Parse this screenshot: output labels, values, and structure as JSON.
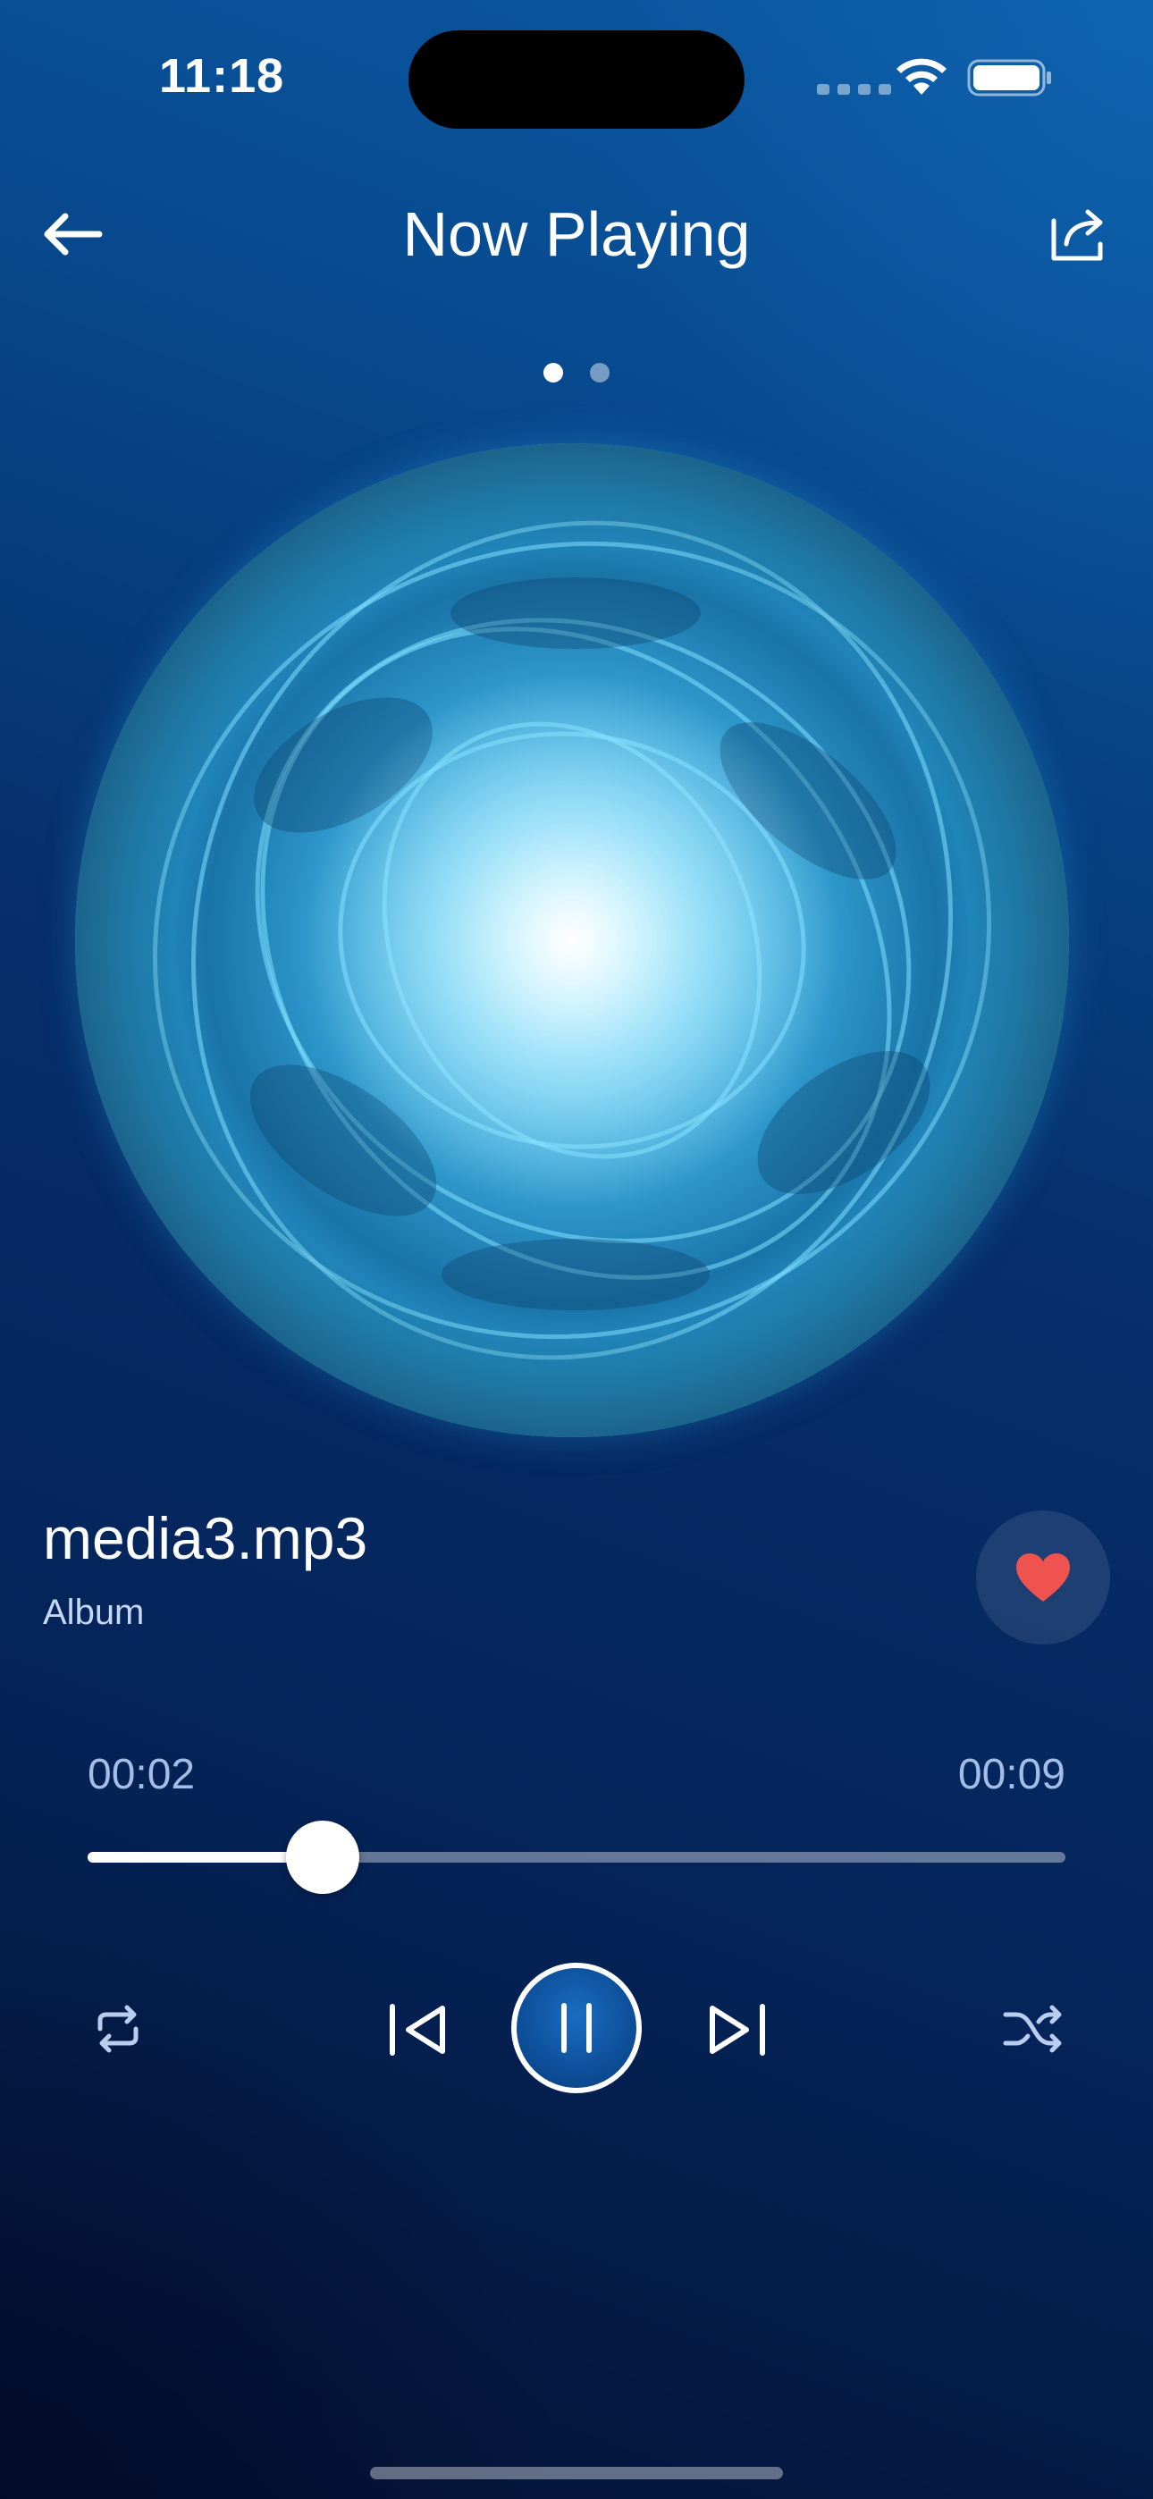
{
  "status_bar": {
    "time": "11:18",
    "icons": [
      "cellular-signal-icon",
      "wifi-icon",
      "battery-icon"
    ]
  },
  "header": {
    "title": "Now Playing",
    "back_icon": "arrow-left-icon",
    "share_icon": "share-icon"
  },
  "pager": {
    "page_count": 2,
    "active_index": 0
  },
  "track": {
    "title": "media3.mp3",
    "album": "Album",
    "is_favorite": true,
    "favorite_color": "#ef5350"
  },
  "playback": {
    "elapsed": "00:02",
    "total": "00:09",
    "progress_fraction": 0.24,
    "state": "playing"
  },
  "controls": {
    "repeat_icon": "repeat-icon",
    "previous_icon": "skip-previous-icon",
    "play_pause_icon": "pause-icon",
    "next_icon": "skip-next-icon",
    "shuffle_icon": "shuffle-icon"
  },
  "colors": {
    "background_top": "#0b5aa4",
    "background_bottom": "#031233",
    "accent": "#0d4f99",
    "secondary_text": "#a3bde6"
  }
}
